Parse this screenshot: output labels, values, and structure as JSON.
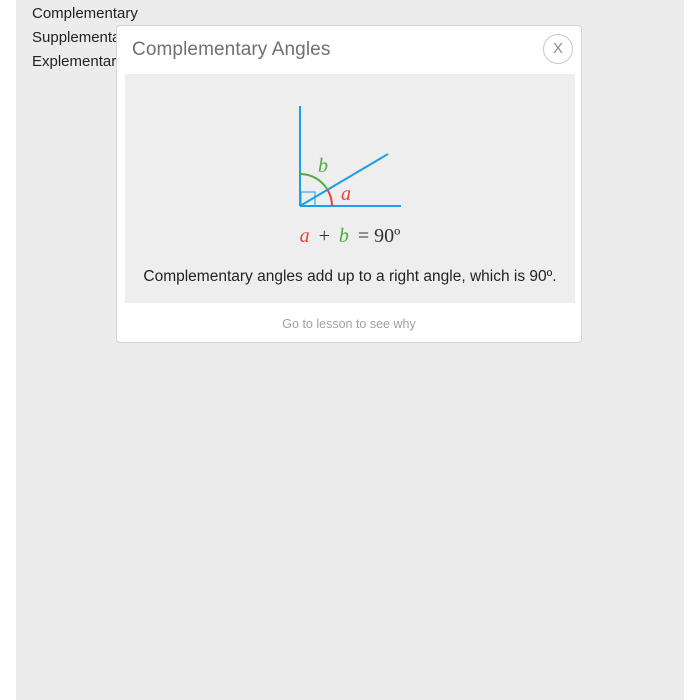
{
  "options": [
    {
      "label": "Complementary"
    },
    {
      "label": "Supplementary"
    },
    {
      "label": "Explementary"
    }
  ],
  "modal": {
    "title": "Complementary Angles",
    "close_label": "X",
    "diagram": {
      "angle_a_label": "a",
      "angle_b_label": "b",
      "equation": {
        "a": "a",
        "plus": "+",
        "b": "b",
        "equals_rhs": "= 90º"
      },
      "colors": {
        "lines": "#1a9fe8",
        "angle_a": "#e8433a",
        "angle_b": "#4cae3c",
        "right_angle_mark": "#1a9fe8",
        "equation_text": "#333333"
      }
    },
    "explanation": "Complementary angles add up to a right angle, which is 90º.",
    "link_label": "Go to lesson to see why"
  }
}
